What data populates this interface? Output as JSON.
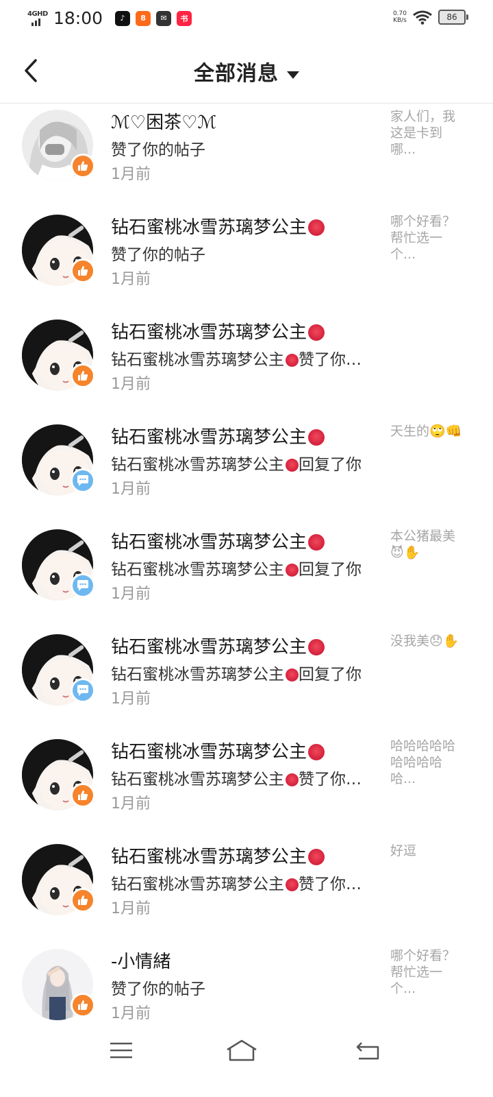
{
  "status_bar": {
    "network": "4GHD",
    "time": "18:00",
    "speed_value": "0.70",
    "speed_unit": "KB/s",
    "battery": "86",
    "apps": [
      {
        "name": "tiktok-icon",
        "color": "#111111",
        "glyph": "♪"
      },
      {
        "name": "kuaishou-icon",
        "color": "#ff6a1a",
        "glyph": "8"
      },
      {
        "name": "wechat-icon",
        "color": "#333333",
        "glyph": "✉"
      },
      {
        "name": "xiaohongshu-icon",
        "color": "#ff2442",
        "glyph": "书"
      }
    ]
  },
  "header": {
    "title": "全部消息"
  },
  "messages": [
    {
      "name": "ℳ♡困茶♡ℳ",
      "angry": false,
      "action": "赞了你的帖子",
      "time": "1月前",
      "type": "like",
      "preview": "家人们，我这是卡到哪...",
      "avatar": "gray"
    },
    {
      "name": "钻石蜜桃冰雪苏璃梦公主",
      "angry": true,
      "action": "赞了你的帖子",
      "time": "1月前",
      "type": "like",
      "preview": "哪个好看？帮忙选一个...",
      "avatar": "anime"
    },
    {
      "name": "钻石蜜桃冰雪苏璃梦公主",
      "angry": true,
      "action_prefix": "钻石蜜桃冰雪苏璃梦公主",
      "action_suffix": "赞了你…",
      "time": "1月前",
      "type": "like",
      "preview": "",
      "avatar": "anime"
    },
    {
      "name": "钻石蜜桃冰雪苏璃梦公主",
      "angry": true,
      "action_prefix": "钻石蜜桃冰雪苏璃梦公主",
      "action_suffix": "回复了你",
      "time": "1月前",
      "type": "reply",
      "preview": "天生的🙄👊",
      "avatar": "anime"
    },
    {
      "name": "钻石蜜桃冰雪苏璃梦公主",
      "angry": true,
      "action_prefix": "钻石蜜桃冰雪苏璃梦公主",
      "action_suffix": "回复了你",
      "time": "1月前",
      "type": "reply",
      "preview": "本公猪最美😈✋",
      "avatar": "anime"
    },
    {
      "name": "钻石蜜桃冰雪苏璃梦公主",
      "angry": true,
      "action_prefix": "钻石蜜桃冰雪苏璃梦公主",
      "action_suffix": "回复了你",
      "time": "1月前",
      "type": "reply",
      "preview": "没我美😞✋",
      "avatar": "anime"
    },
    {
      "name": "钻石蜜桃冰雪苏璃梦公主",
      "angry": true,
      "action_prefix": "钻石蜜桃冰雪苏璃梦公主",
      "action_suffix": "赞了你…",
      "time": "1月前",
      "type": "like",
      "preview": "哈哈哈哈哈哈哈哈哈哈...",
      "avatar": "anime"
    },
    {
      "name": "钻石蜜桃冰雪苏璃梦公主",
      "angry": true,
      "action_prefix": "钻石蜜桃冰雪苏璃梦公主",
      "action_suffix": "赞了你…",
      "time": "1月前",
      "type": "like",
      "preview": "好逗",
      "avatar": "anime"
    },
    {
      "name": "-小情緒",
      "angry": false,
      "action": "赞了你的帖子",
      "time": "1月前",
      "type": "like",
      "preview": "哪个好看？帮忙选一个...",
      "avatar": "girl"
    }
  ],
  "colors": {
    "like_badge": "#f5842c",
    "reply_badge": "#6eb8f0"
  }
}
